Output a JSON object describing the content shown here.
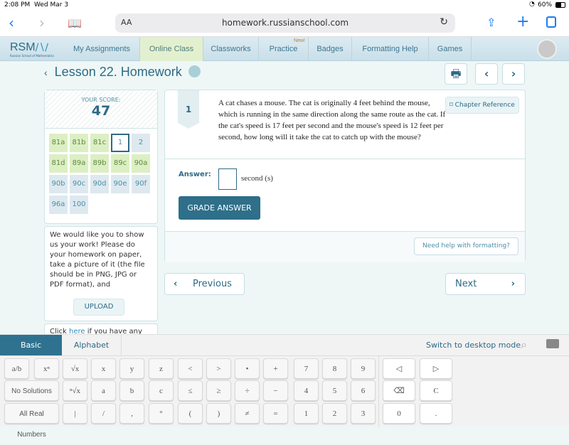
{
  "status": {
    "time": "2:08 PM",
    "date": "Wed Mar 3",
    "battery": "60%"
  },
  "browser": {
    "text_size": "AA",
    "url": "homework.russianschool.com"
  },
  "nav": {
    "logo": "RSM",
    "logo_sub": "Russian School of Mathematics",
    "items": [
      {
        "label": "My Assignments"
      },
      {
        "label": "Online Class",
        "active": true
      },
      {
        "label": "Classworks"
      },
      {
        "label": "Practice",
        "badge": "New!"
      },
      {
        "label": "Badges"
      },
      {
        "label": "Formatting Help"
      },
      {
        "label": "Games"
      }
    ]
  },
  "lesson": {
    "title": "Lesson 22. Homework"
  },
  "score": {
    "label": "YOUR SCORE:",
    "value": "47"
  },
  "problems": [
    {
      "id": "81a",
      "state": "done"
    },
    {
      "id": "81b",
      "state": "done"
    },
    {
      "id": "81c",
      "state": "done"
    },
    {
      "id": "1",
      "state": "current"
    },
    {
      "id": "2",
      "state": "todo"
    },
    {
      "id": "81d",
      "state": "done"
    },
    {
      "id": "89a",
      "state": "done"
    },
    {
      "id": "89b",
      "state": "done"
    },
    {
      "id": "89c",
      "state": "done"
    },
    {
      "id": "90a",
      "state": "done"
    },
    {
      "id": "90b",
      "state": "todo"
    },
    {
      "id": "90c",
      "state": "todo"
    },
    {
      "id": "90d",
      "state": "todo"
    },
    {
      "id": "90e",
      "state": "todo"
    },
    {
      "id": "90f",
      "state": "todo"
    },
    {
      "id": "96a",
      "state": "todo"
    },
    {
      "id": "100",
      "state": "todo"
    }
  ],
  "upload": {
    "text": "We would like you to show us your work! Please do your homework on paper, take a picture of it (the file should be in PNG, JPG or PDF format), and",
    "button": "UPLOAD",
    "click_pre": "Click ",
    "click_link": "here",
    "click_post": " if you have any"
  },
  "question": {
    "number": "1",
    "chapter_ref": "Chapter Reference",
    "text": "A cat chases a mouse. The cat is originally 4 feet behind the mouse, which is running in the same direction along the same route as the cat. If the cat's speed is 17 feet per second and the mouse's speed is 12 feet per second, how long will it take the cat to catch up with the mouse?",
    "answer_label": "Answer:",
    "answer_value": "",
    "unit": "second (s)",
    "grade": "GRADE ANSWER",
    "help": "Need help with formatting?"
  },
  "pager": {
    "previous": "Previous",
    "next": "Next"
  },
  "keyboard": {
    "tabs": [
      "Basic",
      "Alphabet"
    ],
    "active_tab": "Basic",
    "desktop": "Switch to desktop mode",
    "rows": [
      [
        "a/b",
        "xⁿ",
        "√x",
        "x",
        "y",
        "z",
        "<",
        ">",
        "•",
        "+",
        "7",
        "8",
        "9"
      ],
      [
        "No Solutions",
        "ⁿ√x",
        "a",
        "b",
        "c",
        "≤",
        "≥",
        "÷",
        "−",
        "4",
        "5",
        "6"
      ],
      [
        "All Real Numbers",
        "|",
        "/",
        ",",
        "°",
        "(",
        ")",
        "≠",
        "=",
        "1",
        "2",
        "3"
      ]
    ],
    "side": [
      [
        "◁",
        "▷"
      ],
      [
        "⌫",
        "C"
      ],
      [
        "0",
        "."
      ]
    ]
  }
}
